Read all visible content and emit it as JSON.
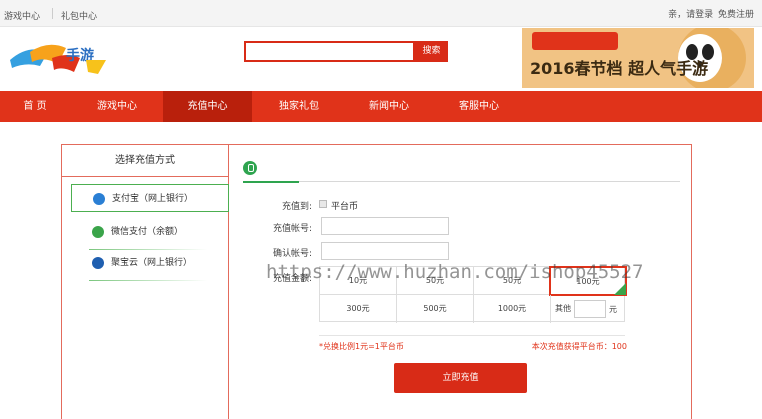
{
  "topbar": {
    "link_games": "游戏中心",
    "link_gifts": "礼包中心",
    "greeting": "亲，请登录",
    "register": "免费注册"
  },
  "header": {
    "logo_text": "手游",
    "search_placeholder": "",
    "search_button": "搜索",
    "banner_text": "2016春节档 超人气手游"
  },
  "nav": {
    "items": [
      "首 页",
      "游戏中心",
      "充值中心",
      "独家礼包",
      "新闻中心",
      "客服中心"
    ],
    "active_index": 2
  },
  "sidebar": {
    "title": "选择充值方式",
    "methods": [
      {
        "label": "支付宝（网上银行）",
        "icon": "alipay-icon",
        "color": "#2a7fd4"
      },
      {
        "label": "微信支付（余额）",
        "icon": "wechat-icon",
        "color": "#3aa44a"
      },
      {
        "label": "聚宝云（网上银行）",
        "icon": "jubaoyun-icon",
        "color": "#1f5fb0"
      }
    ]
  },
  "form": {
    "recharge_to_label": "充值到:",
    "recharge_to_value": "平台币",
    "account_label": "充值帐号:",
    "confirm_label": "确认帐号:",
    "amount_label": "充值金额:",
    "amounts": [
      "10元",
      "50元",
      "50元",
      "100元",
      "300元",
      "500元",
      "1000元"
    ],
    "selected_amount": "100元",
    "other_label": "其他",
    "other_unit": "元",
    "ratio_text": "*兑换比例1元=1平台币",
    "earn_text": "本次充值获得平台币：100",
    "submit": "立即充值"
  },
  "watermark": "https://www.huzhan.com/ishop45527",
  "colors": {
    "brand_red": "#d82b17",
    "nav_red": "#e0331a",
    "active_nav": "#b9200c",
    "green": "#2ea44f"
  }
}
